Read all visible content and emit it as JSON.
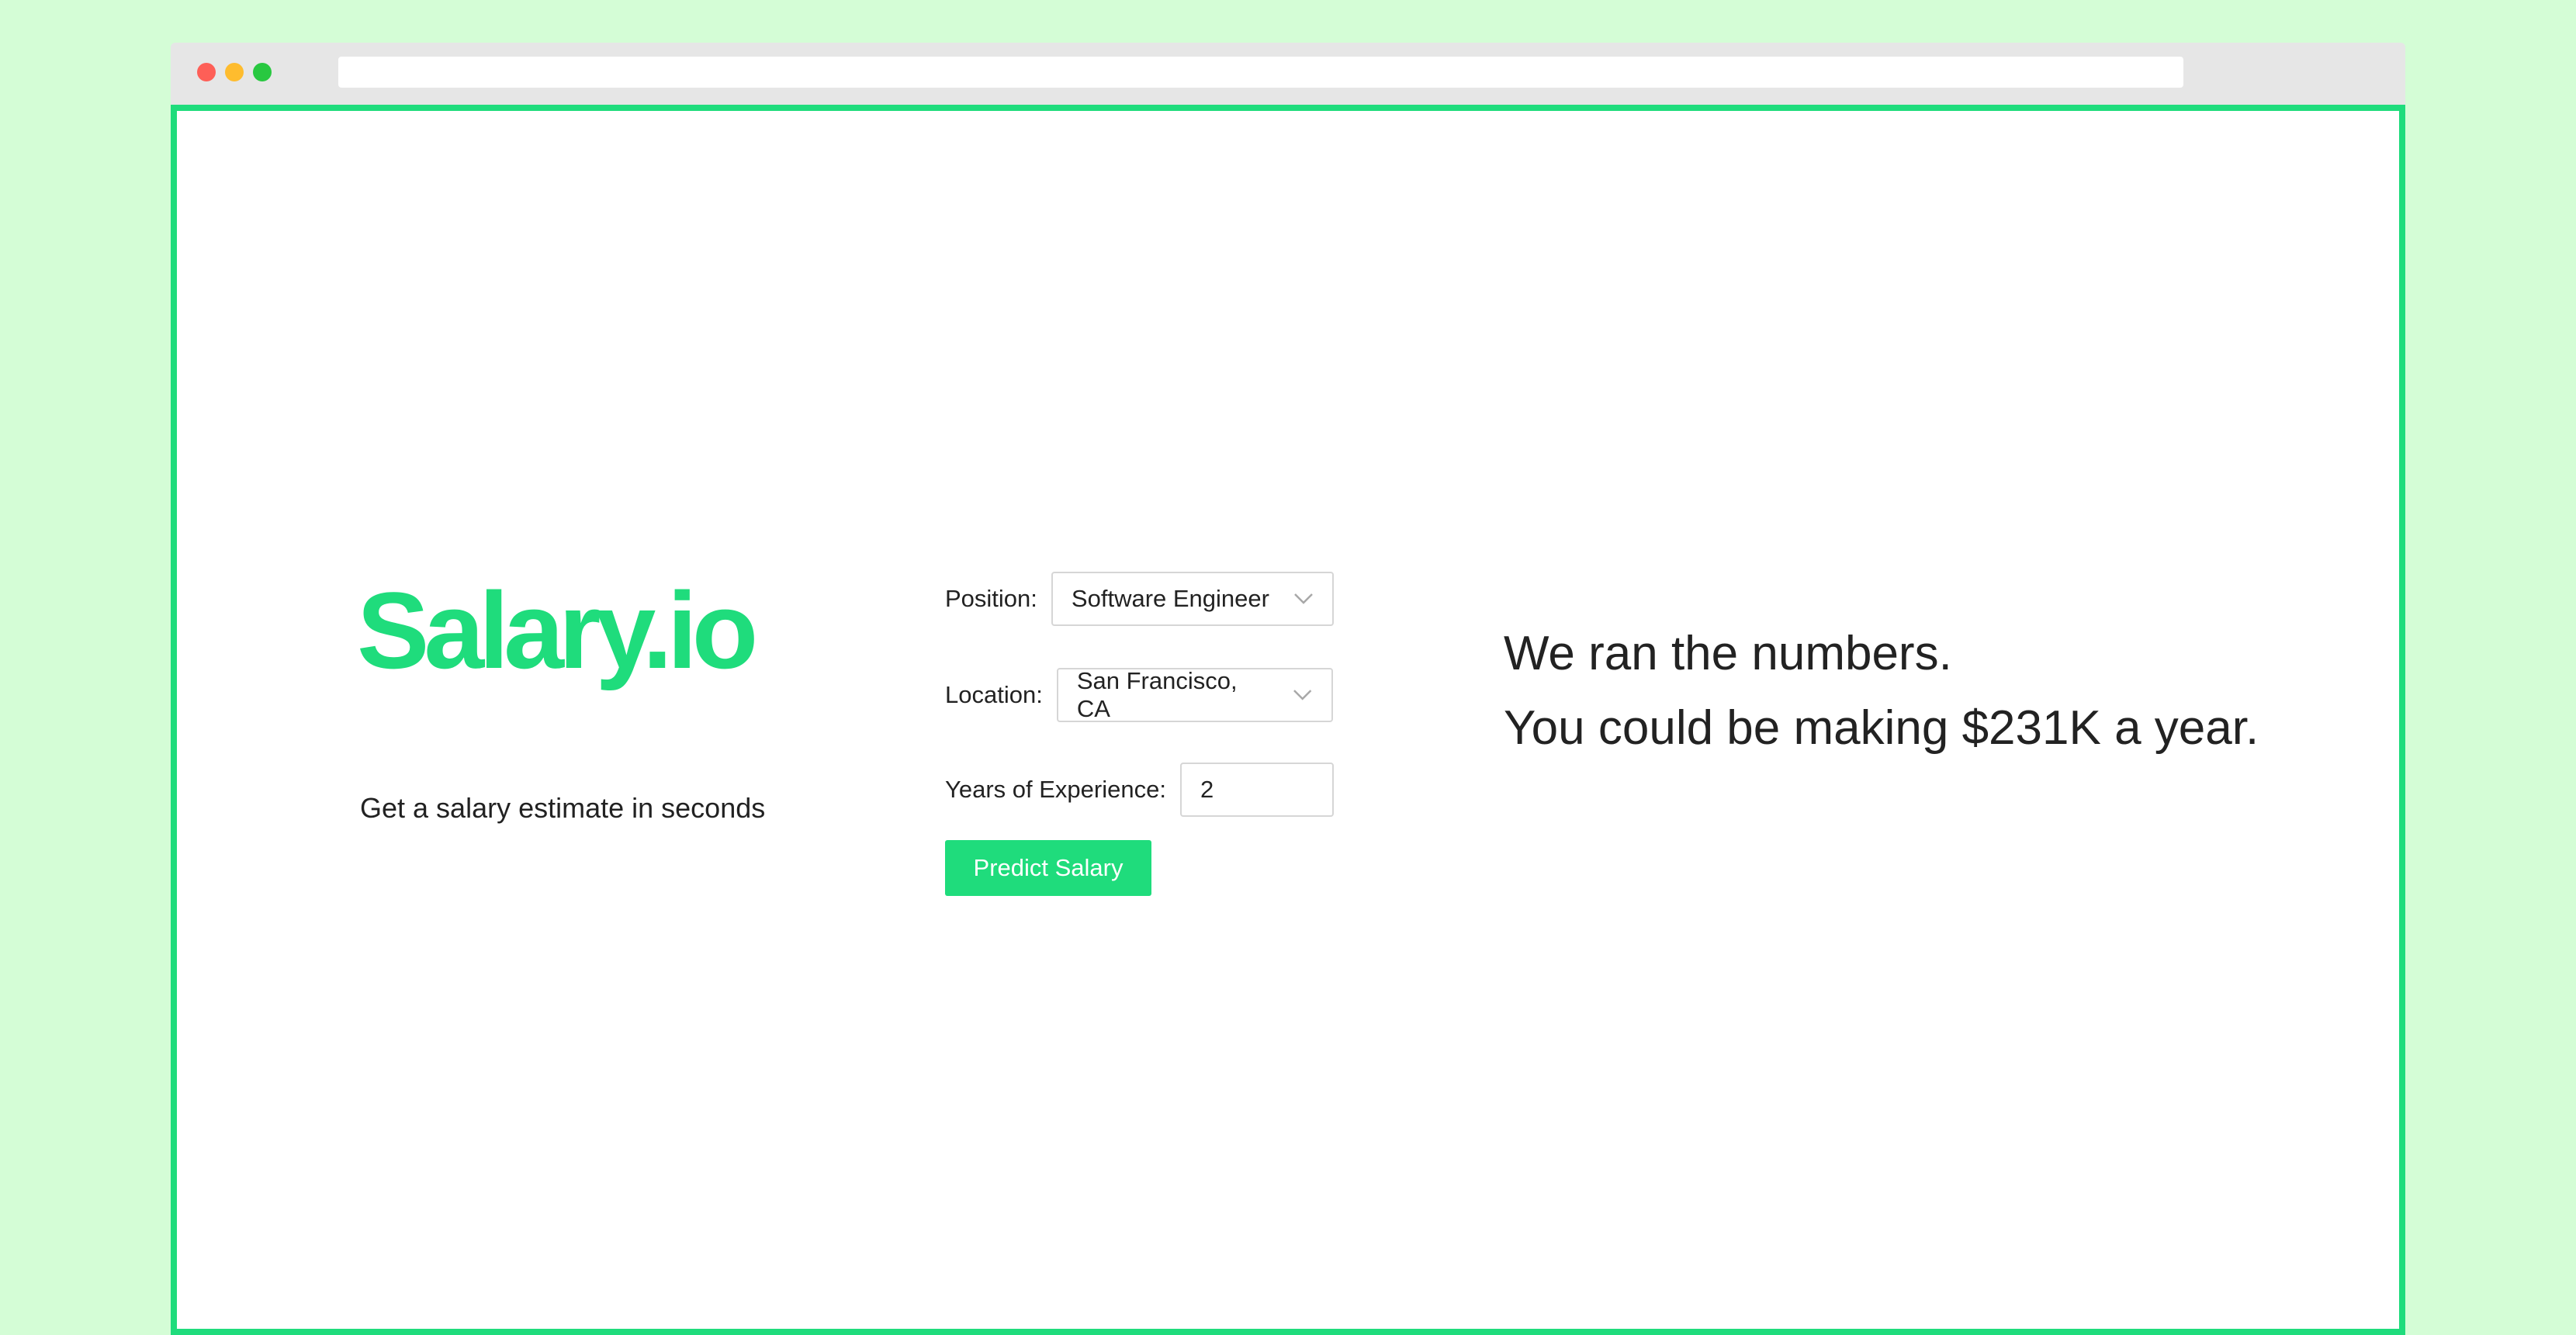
{
  "browser": {
    "url": ""
  },
  "app": {
    "logo": "Salary.io",
    "tagline": "Get a salary estimate in seconds",
    "brand_color": "#1fdc7c"
  },
  "form": {
    "position": {
      "label": "Position",
      "colon": ":",
      "value": "Software Engineer"
    },
    "location": {
      "label": "Location",
      "colon": ":",
      "value": "San Francisco, CA"
    },
    "experience": {
      "label": "Years of Experience",
      "colon": ":",
      "value": "2"
    },
    "submit_label": "Predict Salary"
  },
  "result": {
    "line1": "We ran the numbers.",
    "line2": "You could be making $231K a year."
  },
  "icons": {
    "dropdown": "chevron-down-icon"
  }
}
